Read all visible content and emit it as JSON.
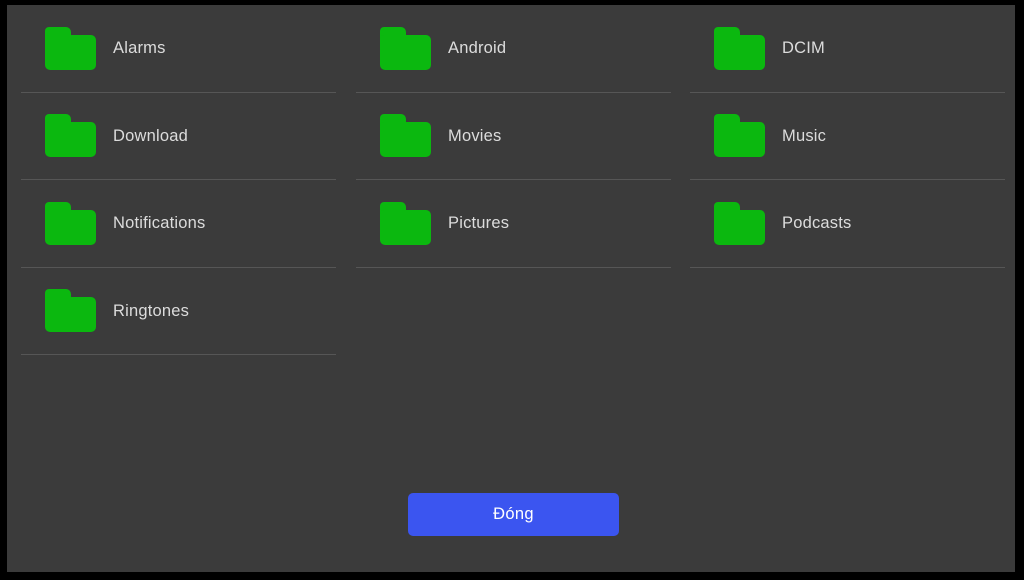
{
  "dialog": {
    "title": "",
    "background_color": "#3b3b3b",
    "frame_color": "#000000"
  },
  "folders": {
    "icon_name": "folder-icon",
    "icon_color": "#0bb80f",
    "columns": [
      [
        {
          "label": "Alarms"
        },
        {
          "label": "Download"
        },
        {
          "label": "Notifications"
        },
        {
          "label": "Ringtones"
        }
      ],
      [
        {
          "label": "Android"
        },
        {
          "label": "Movies"
        },
        {
          "label": "Pictures"
        }
      ],
      [
        {
          "label": "DCIM"
        },
        {
          "label": "Music"
        },
        {
          "label": "Podcasts"
        }
      ]
    ]
  },
  "actions": {
    "close_label": "Đóng",
    "close_color": "#3b55f0"
  }
}
